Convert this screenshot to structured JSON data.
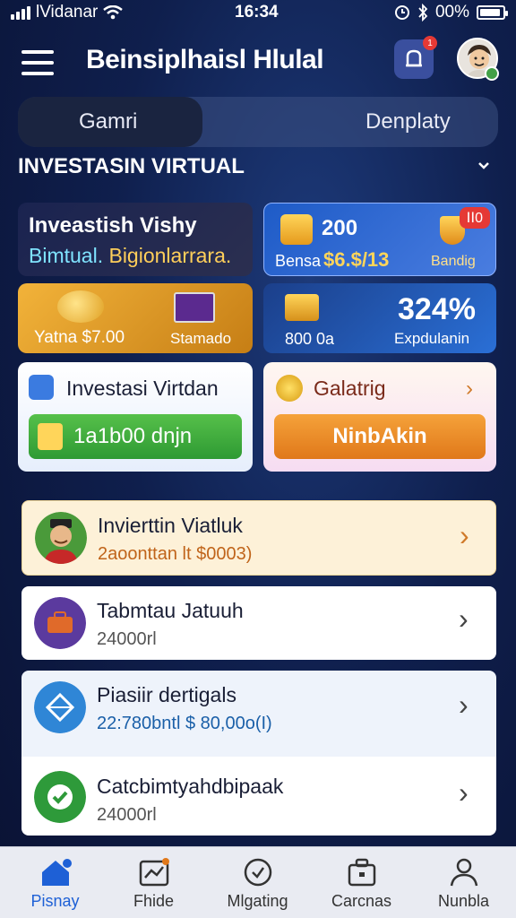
{
  "status_bar": {
    "carrier": "lVidanar",
    "time": "16:34",
    "battery": "00%",
    "battery_level": 0.9
  },
  "app_bar": {
    "title": "Beinsiplhaisl Hlulal",
    "notification_count": "1"
  },
  "tabs": [
    {
      "label": "Gamri",
      "active": true
    },
    {
      "label": "Denplaty",
      "active": false
    }
  ],
  "section": {
    "title": "INVESTASIN VIRTUAL"
  },
  "cards": {
    "promo": {
      "line1": "Inveastish Vishy",
      "line2a": "Bimtual.",
      "line2b": "Bigionlarrara."
    },
    "gold": {
      "amount": "200",
      "label": "Bensa",
      "value": "$6.$/13",
      "badge": "ⅠⅠ0",
      "side_label": "Bandig"
    },
    "wallet": {
      "left": "Yatna $7.00",
      "right": "Stamado"
    },
    "stats": {
      "percent": "324%",
      "left": "800 0a",
      "right": "Expdulanin"
    },
    "invest": {
      "title": "Investasi Virtdan",
      "button": "1a1b00 dnjn"
    },
    "catalog": {
      "title": "Galatrig",
      "button": "NinbAkin"
    }
  },
  "list": [
    {
      "title": "Invierttin Viatluk",
      "subtitle": "2aoonttan lt $0003)",
      "subtitle_color": "#c0641a"
    },
    {
      "title": "Tabmtau Jatuuh",
      "subtitle": "24000rl",
      "subtitle_color": "#555555"
    },
    {
      "title": "Piasiir dertigals",
      "subtitle": "22:780bntl $ 80,00o(I)",
      "subtitle_color": "#1a5fa8"
    },
    {
      "title": "Catcbimtyahdbipaak",
      "subtitle": "24000rl",
      "subtitle_color": "#555555"
    }
  ],
  "bottom_nav": [
    {
      "label": "Pisnay",
      "icon": "home-icon",
      "active": true
    },
    {
      "label": "Fhide",
      "icon": "chart-icon",
      "active": false
    },
    {
      "label": "Mlgating",
      "icon": "clock-icon",
      "active": false
    },
    {
      "label": "Carcnas",
      "icon": "briefcase-icon",
      "active": false
    },
    {
      "label": "Nunbla",
      "icon": "person-icon",
      "active": false
    }
  ],
  "colors": {
    "accent": "#1e60d6",
    "gold": "#ffd55a",
    "green": "#2e9a33",
    "orange": "#e0781a"
  }
}
